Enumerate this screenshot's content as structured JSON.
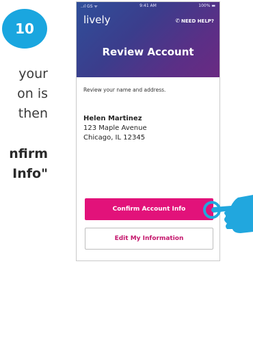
{
  "step": {
    "number": "10"
  },
  "instructions": {
    "lines": [
      "your",
      "on is",
      "then",
      "nfirm",
      "Info\""
    ]
  },
  "phone": {
    "status_bar": {
      "carrier": "..ıl GS ᯤ",
      "time": "9:41 AM",
      "battery": "100% ▬"
    },
    "header": {
      "brand": "lively",
      "help_label": "NEED HELP?",
      "title": "Review Account"
    },
    "intro_text": "Review your name and address.",
    "account": {
      "name": "Helen Martinez",
      "street": "123 Maple Avenue",
      "city_state_zip": "Chicago, IL 12345"
    },
    "buttons": {
      "confirm_label": "Confirm Account Info",
      "edit_label": "Edit My Information"
    }
  },
  "colors": {
    "badge": "#1aa6df",
    "primary_button": "#e2127a",
    "header_start": "#2f4f9a",
    "header_end": "#6a2a82",
    "pointer": "#21a7de"
  },
  "icons": [
    "phone-icon",
    "pointing-hand-icon",
    "signal-icon",
    "battery-icon"
  ]
}
